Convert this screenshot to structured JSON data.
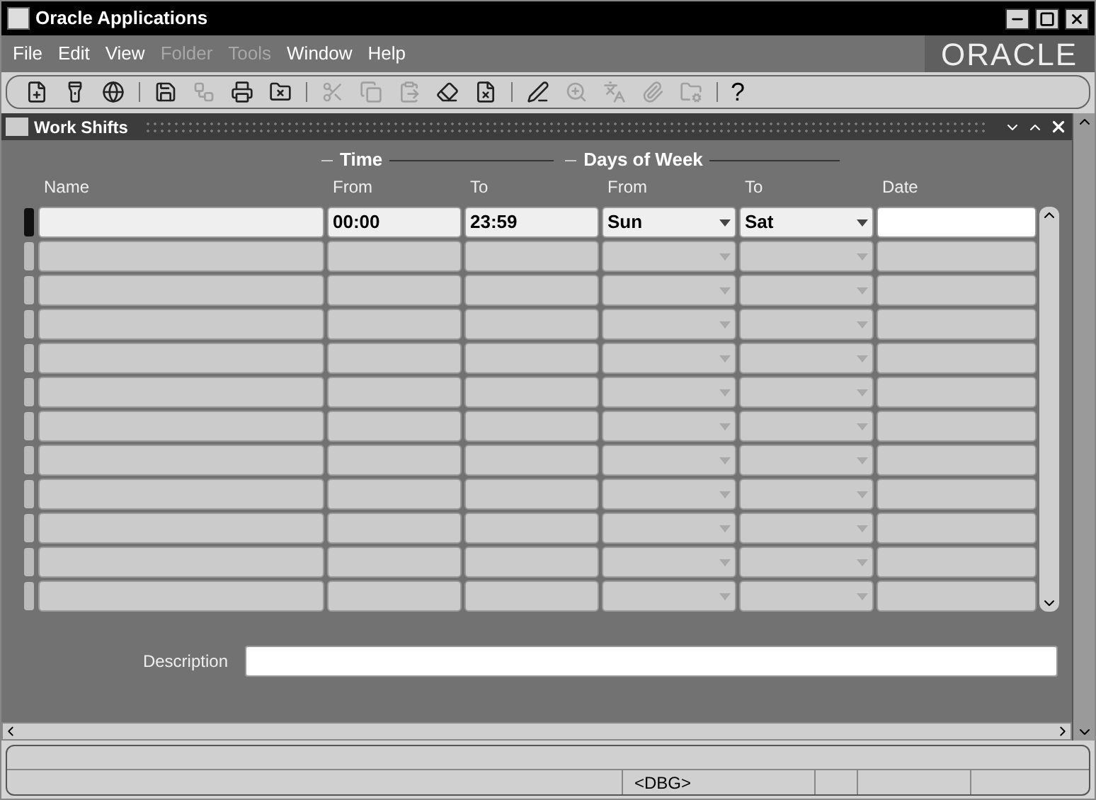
{
  "window": {
    "title": "Oracle Applications"
  },
  "menu": [
    {
      "label": "File",
      "disabled": false
    },
    {
      "label": "Edit",
      "disabled": false
    },
    {
      "label": "View",
      "disabled": false
    },
    {
      "label": "Folder",
      "disabled": true
    },
    {
      "label": "Tools",
      "disabled": true
    },
    {
      "label": "Window",
      "disabled": false
    },
    {
      "label": "Help",
      "disabled": false
    }
  ],
  "logo": "ORACLE",
  "toolbar": [
    {
      "kind": "button",
      "disabled": false
    },
    {
      "kind": "button",
      "disabled": false
    },
    {
      "kind": "button",
      "disabled": false
    },
    {
      "kind": "separator"
    },
    {
      "kind": "button",
      "disabled": false
    },
    {
      "kind": "button",
      "disabled": true
    },
    {
      "kind": "button",
      "disabled": false
    },
    {
      "kind": "button",
      "disabled": false
    },
    {
      "kind": "separator"
    },
    {
      "kind": "button",
      "disabled": true
    },
    {
      "kind": "button",
      "disabled": true
    },
    {
      "kind": "button",
      "disabled": true
    },
    {
      "kind": "button",
      "disabled": false
    },
    {
      "kind": "button",
      "disabled": false
    },
    {
      "kind": "separator"
    },
    {
      "kind": "button",
      "disabled": false
    },
    {
      "kind": "button",
      "disabled": true
    },
    {
      "kind": "button",
      "disabled": true
    },
    {
      "kind": "button",
      "disabled": true
    },
    {
      "kind": "button",
      "disabled": true
    },
    {
      "kind": "separator"
    },
    {
      "kind": "help",
      "label": "?",
      "disabled": false
    }
  ],
  "form": {
    "title": "Work Shifts",
    "groups": [
      "Time",
      "Days of Week"
    ],
    "columns": [
      "Name",
      "From",
      "To",
      "From",
      "To",
      "Date"
    ],
    "rows": [
      {
        "current": true,
        "time_from": "00:00",
        "time_to": "23:59",
        "day_from": "Sun",
        "day_to": "Sat"
      },
      {
        "current": false
      },
      {
        "current": false
      },
      {
        "current": false
      },
      {
        "current": false
      },
      {
        "current": false
      },
      {
        "current": false
      },
      {
        "current": false
      },
      {
        "current": false
      },
      {
        "current": false
      },
      {
        "current": false
      },
      {
        "current": false
      }
    ],
    "description_label": "Description"
  },
  "status_bar": {
    "cells": [
      "<DBG>"
    ]
  }
}
